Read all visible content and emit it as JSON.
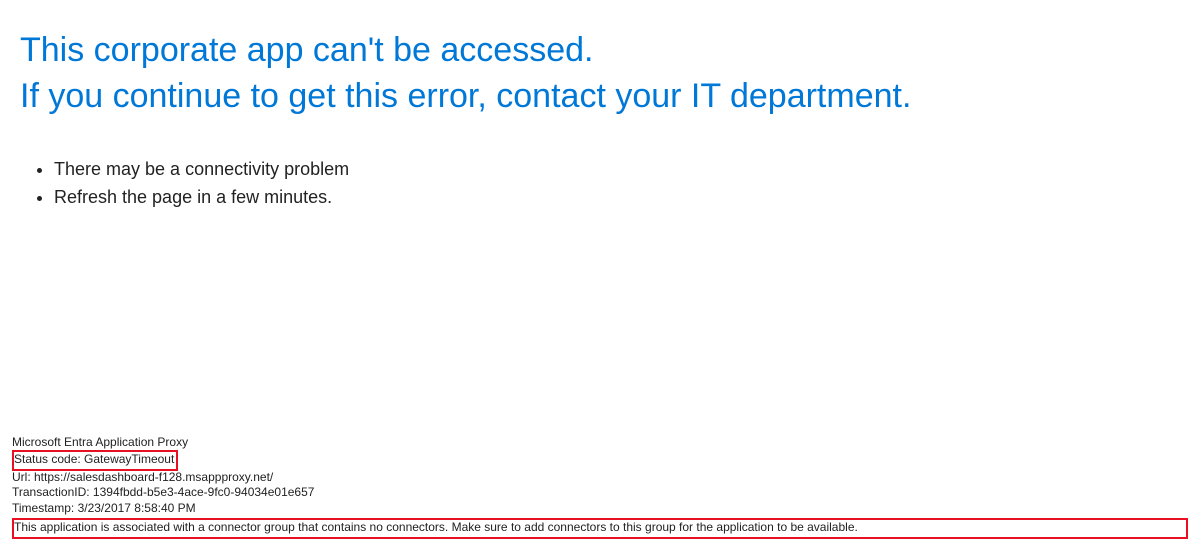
{
  "heading": {
    "line1": "This corporate app can't be accessed.",
    "line2": "If you continue to get this error, contact your IT department."
  },
  "bullets": {
    "item1": "There may be a connectivity problem",
    "item2": "Refresh the page in a few minutes."
  },
  "details": {
    "product": "Microsoft Entra Application Proxy",
    "status_code_label": "Status code: ",
    "status_code_value": "GatewayTimeout",
    "url_label": "Url: ",
    "url_value": "https://salesdashboard-f128.msappproxy.net/",
    "transaction_label": "TransactionID: ",
    "transaction_value": "1394fbdd-b5e3-4ace-9fc0-94034e01e657",
    "timestamp_label": "Timestamp: ",
    "timestamp_value": "3/23/2017 8:58:40 PM",
    "message": "This application is associated with a connector group that contains no connectors. Make sure to add connectors to this group for the application to be available."
  }
}
